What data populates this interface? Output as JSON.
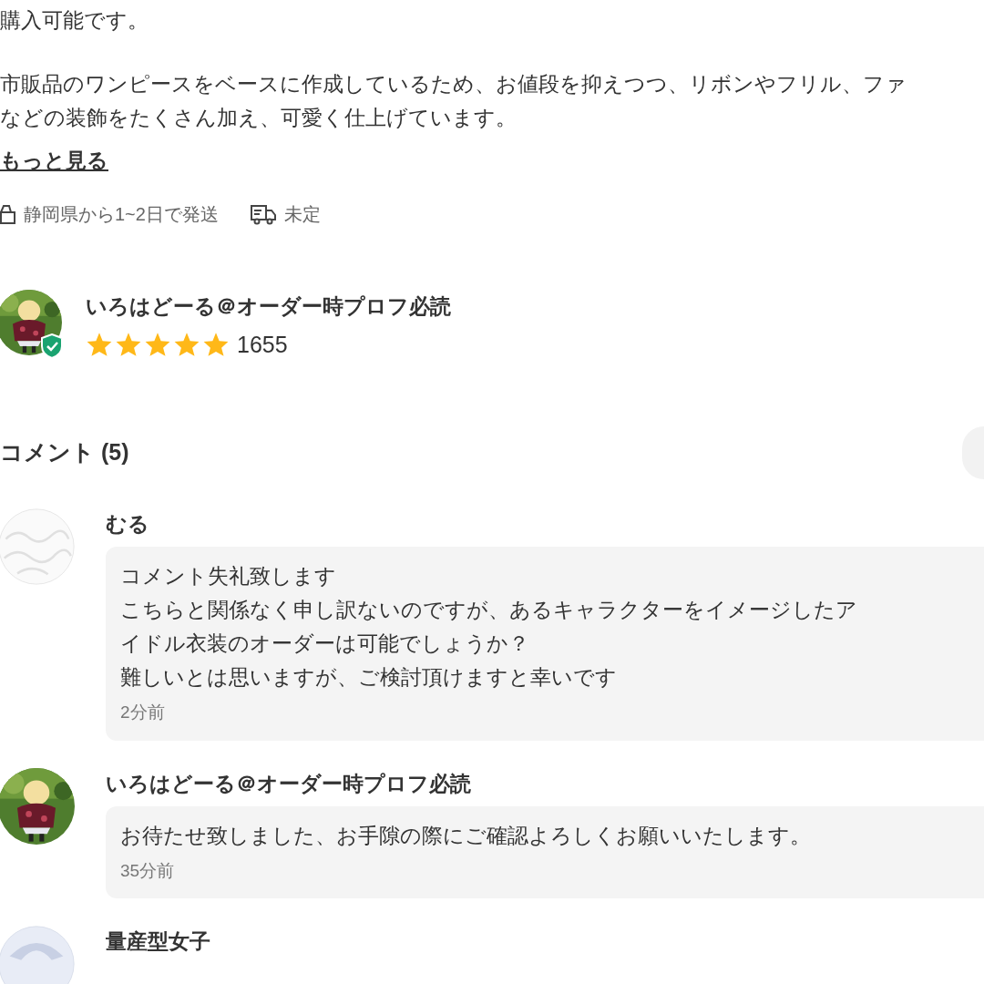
{
  "description": {
    "paragraphs": [
      [
        "購入可能です。"
      ],
      [
        "市販品のワンピースをベースに作成しているため、お値段を抑えつつ、リボンやフリル、ファ",
        "などの装飾をたくさん加え、可愛く仕上げています。"
      ]
    ],
    "more_link": "もっと見る"
  },
  "shipping": [
    {
      "kind": "origin",
      "text": "静岡県から1~2日で発送"
    },
    {
      "kind": "method",
      "text": "未定"
    }
  ],
  "seller": {
    "name": "いろはどーる＠オーダー時プロフ必読",
    "verified": true,
    "stars": 5,
    "rating_count": "1655"
  },
  "comments": {
    "title": "コメント (5)",
    "items": [
      {
        "user": "むる",
        "kind": "pattern",
        "lines": [
          "コメント失礼致します",
          "こちらと関係なく申し訳ないのですが、あるキャラクターをイメージしたア",
          "イドル衣装のオーダーは可能でしょうか？",
          "難しいとは思いますが、ご検討頂けますと幸いです"
        ],
        "time": "2分前"
      },
      {
        "user": "いろはどーる＠オーダー時プロフ必読",
        "kind": "picture",
        "lines": [
          "お待たせ致しました、お手隙の際にご確認よろしくお願いいたします。"
        ],
        "time": "35分前"
      },
      {
        "user": "量産型女子",
        "kind": "drawing"
      }
    ]
  }
}
